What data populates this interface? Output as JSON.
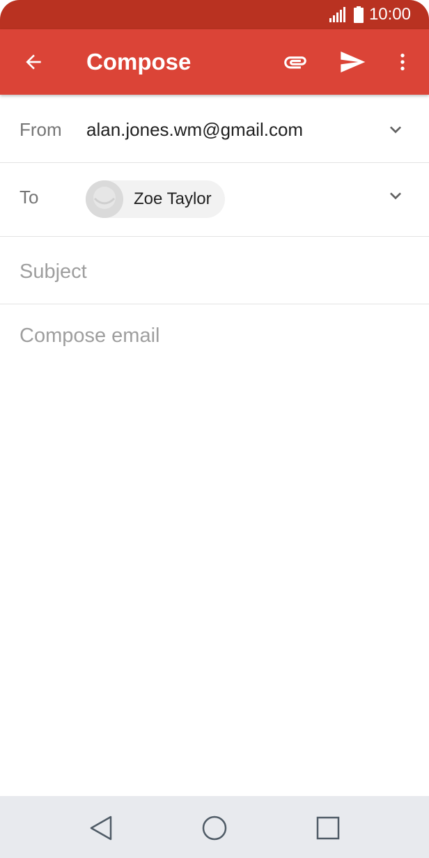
{
  "status_bar": {
    "time": "10:00",
    "icons": [
      "signal-icon",
      "battery-icon"
    ]
  },
  "app_bar": {
    "title": "Compose",
    "icons": [
      "back-arrow-icon",
      "attachment-icon",
      "send-icon",
      "more-vert-icon"
    ]
  },
  "from": {
    "label": "From",
    "value": "alan.jones.wm@gmail.com"
  },
  "to": {
    "label": "To",
    "recipient_name": "Zoe Taylor"
  },
  "subject": {
    "placeholder": "Subject",
    "value": ""
  },
  "body": {
    "placeholder": "Compose email",
    "value": ""
  },
  "nav_bar": {
    "icons": [
      "nav-back-icon",
      "nav-home-icon",
      "nav-recents-icon"
    ]
  },
  "colors": {
    "status_bar": "#b93221",
    "app_bar": "#db4437",
    "nav_bar": "#e8eaee"
  }
}
